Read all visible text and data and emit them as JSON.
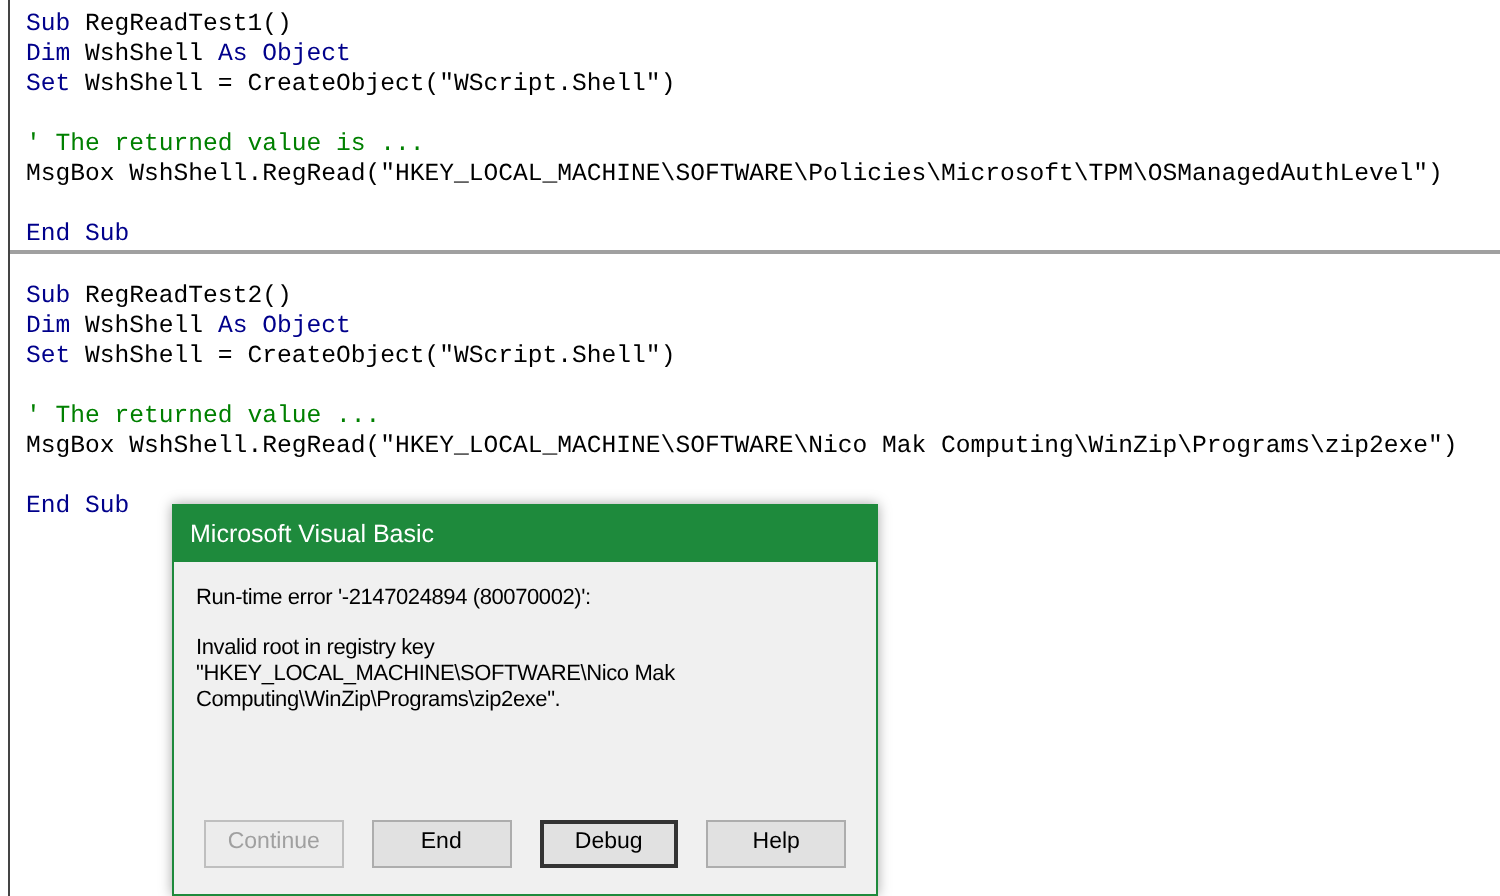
{
  "code_panes": [
    {
      "paragraphs": [
        [
          [
            {
              "text": "Sub",
              "kind": "keyword"
            },
            {
              "text": " RegReadTest1()",
              "kind": "plain"
            }
          ],
          [
            {
              "text": "Dim",
              "kind": "keyword"
            },
            {
              "text": " WshShell ",
              "kind": "plain"
            },
            {
              "text": "As Object",
              "kind": "keyword"
            }
          ],
          [
            {
              "text": "Set",
              "kind": "keyword"
            },
            {
              "text": " WshShell = CreateObject(\"WScript.Shell\")",
              "kind": "plain"
            }
          ]
        ],
        [
          [
            {
              "text": "' The returned value is ...",
              "kind": "comment"
            }
          ],
          [
            {
              "text": "MsgBox WshShell.RegRead(\"HKEY_LOCAL_MACHINE\\SOFTWARE\\Policies\\Microsoft\\TPM\\OSManagedAuthLevel\")",
              "kind": "plain"
            }
          ]
        ],
        [
          [
            {
              "text": "End Sub",
              "kind": "keyword"
            }
          ]
        ]
      ]
    },
    {
      "paragraphs": [
        [
          [
            {
              "text": "Sub",
              "kind": "keyword"
            },
            {
              "text": " RegReadTest2()",
              "kind": "plain"
            }
          ],
          [
            {
              "text": "Dim",
              "kind": "keyword"
            },
            {
              "text": " WshShell ",
              "kind": "plain"
            },
            {
              "text": "As Object",
              "kind": "keyword"
            }
          ],
          [
            {
              "text": "Set",
              "kind": "keyword"
            },
            {
              "text": " WshShell = CreateObject(\"WScript.Shell\")",
              "kind": "plain"
            }
          ]
        ],
        [
          [
            {
              "text": "' The returned value ...",
              "kind": "comment"
            }
          ],
          [
            {
              "text": "MsgBox WshShell.RegRead(\"HKEY_LOCAL_MACHINE\\SOFTWARE\\Nico Mak Computing\\WinZip\\Programs\\zip2exe\")",
              "kind": "plain"
            }
          ]
        ],
        [
          [
            {
              "text": "End Sub",
              "kind": "keyword"
            }
          ]
        ]
      ]
    }
  ],
  "dialog": {
    "title": "Microsoft Visual Basic",
    "error": "Run-time error '-2147024894 (80070002)':",
    "message": "Invalid root in registry key \"HKEY_LOCAL_MACHINE\\SOFTWARE\\Nico Mak Computing\\WinZip\\Programs\\zip2exe\".",
    "buttons": [
      {
        "label": "Continue",
        "disabled": true,
        "default": false
      },
      {
        "label": "End",
        "disabled": false,
        "default": false
      },
      {
        "label": "Debug",
        "disabled": false,
        "default": true
      },
      {
        "label": "Help",
        "disabled": false,
        "default": false
      }
    ]
  }
}
